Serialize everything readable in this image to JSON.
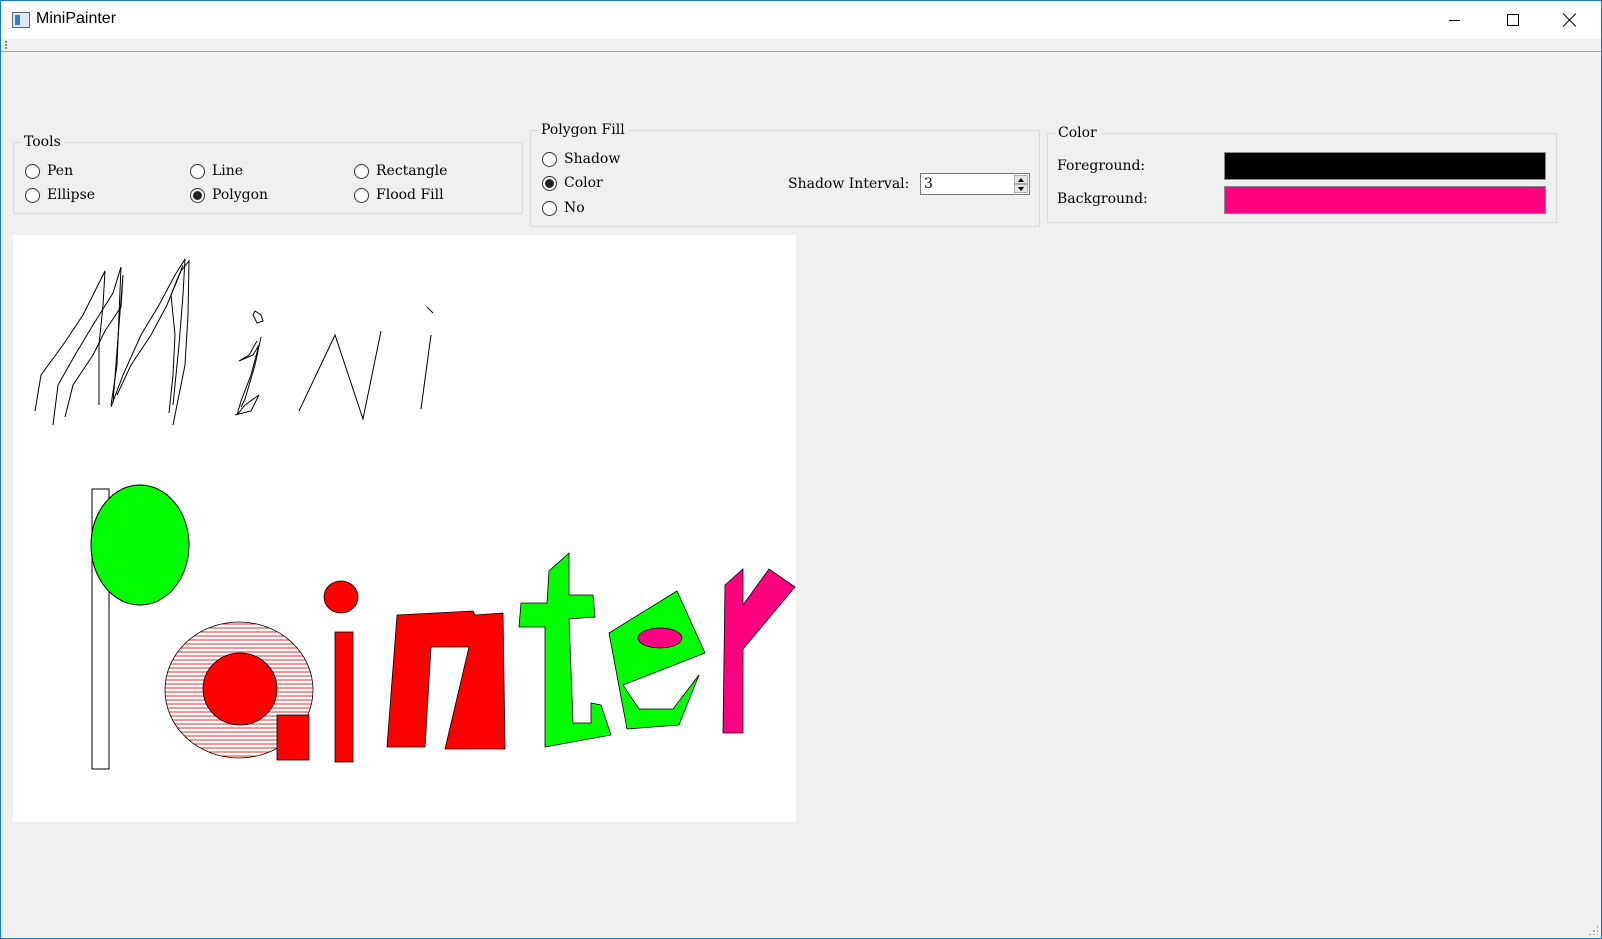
{
  "window": {
    "title": "MiniPainter"
  },
  "tools": {
    "group_title": "Tools",
    "options": [
      {
        "label": "Pen",
        "checked": false
      },
      {
        "label": "Line",
        "checked": false
      },
      {
        "label": "Rectangle",
        "checked": false
      },
      {
        "label": "Ellipse",
        "checked": false
      },
      {
        "label": "Polygon",
        "checked": true
      },
      {
        "label": "Flood Fill",
        "checked": false
      }
    ]
  },
  "polygon_fill": {
    "group_title": "Polygon Fill",
    "options": [
      {
        "label": "Shadow",
        "checked": false
      },
      {
        "label": "Color",
        "checked": true
      },
      {
        "label": "No",
        "checked": false
      }
    ],
    "shadow_interval_label": "Shadow Interval:",
    "shadow_interval_value": "3"
  },
  "color": {
    "group_title": "Color",
    "foreground_label": "Foreground:",
    "foreground_color": "#000000",
    "background_label": "Background:",
    "background_color": "#ff0080"
  },
  "canvas_colors": {
    "green": "#00ff00",
    "red": "#ff0000",
    "pink": "#ff0080",
    "stroke": "#000000"
  }
}
